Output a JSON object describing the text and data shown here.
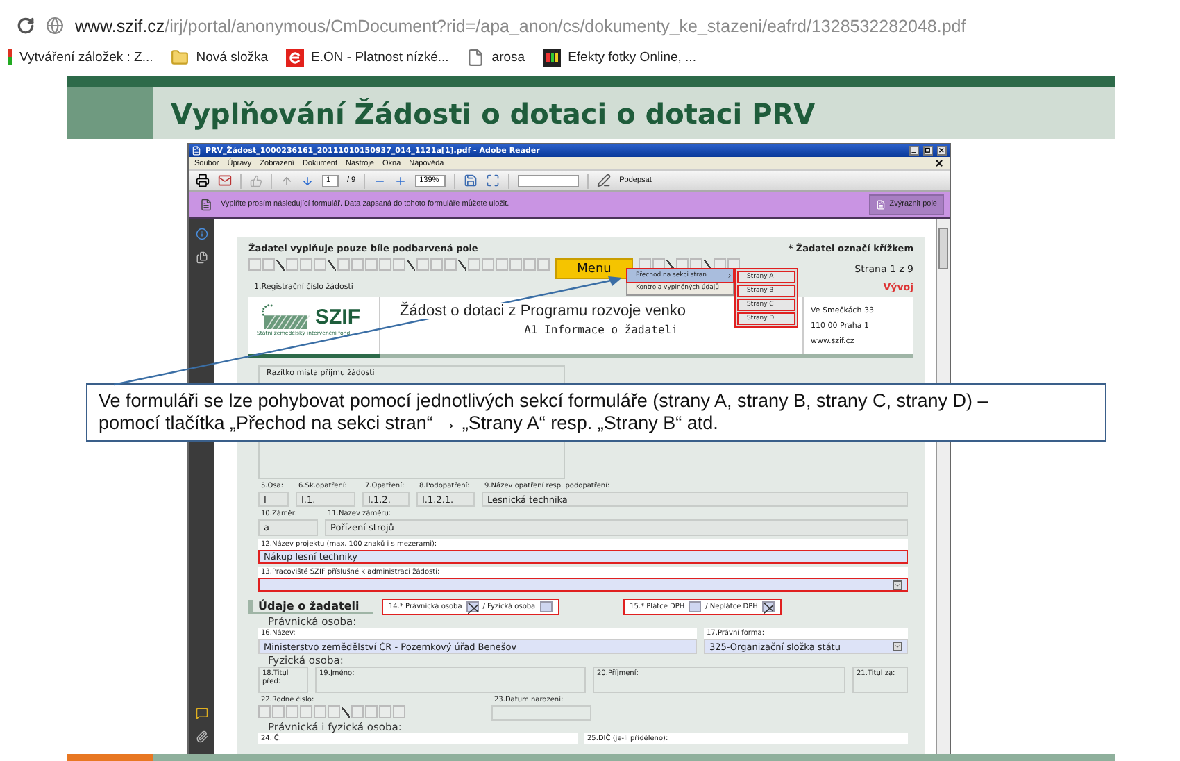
{
  "browser": {
    "url_host": "www.szif.cz",
    "url_path": "/irj/portal/anonymous/CmDocument?rid=/apa_anon/cs/dokumenty_ke_stazeni/eafrd/1328532282048.pdf",
    "bookmarks": [
      {
        "label": "Vytváření záložek : Z...",
        "kind": "bar"
      },
      {
        "label": "Nová složka",
        "kind": "folder"
      },
      {
        "label": "E.ON - Platnost nízké...",
        "kind": "eon"
      },
      {
        "label": "arosa",
        "kind": "page"
      },
      {
        "label": "Efekty fotky Online, ...",
        "kind": "pix"
      }
    ]
  },
  "slide": {
    "title": "Vyplňování Žádosti o dotaci o dotaci PRV",
    "callout": [
      "Ve formuláři se lze pohybovat pomocí jednotlivých sekcí formuláře (strany A, strany B, strany C, strany D) –",
      "pomocí tlačítka „Přechod na sekci stran“ → „Strany A“ resp. „Strany B“ atd."
    ]
  },
  "reader": {
    "title": "PRV_Žádost_1000236161_20111010150937_014_1121a[1].pdf - Adobe Reader",
    "menu": [
      "Soubor",
      "Úpravy",
      "Zobrazení",
      "Dokument",
      "Nástroje",
      "Okna",
      "Nápověda"
    ],
    "toolbar": {
      "page": "1",
      "pages": "/ 9",
      "zoom": "139%",
      "sign": "Podepsat"
    },
    "notice": "Vyplňte prosím následující formulář. Data zapsaná do tohoto formuláře můžete uložit.",
    "highlight_button": "Zvýraznit pole",
    "form": {
      "header_left": "Žadatel vyplňuje pouze bíle podbarvená pole",
      "header_right": "* Žadatel označí křížkem",
      "menu_button": "Menu",
      "page_info": "Strana 1 z 9",
      "reg_label": "1.Registrační číslo žádosti",
      "status": "Vývoj",
      "dropdown": [
        {
          "label": "Přechod na sekci stran",
          "selected": true
        },
        {
          "label": "Kontrola vyplněných údajů",
          "selected": false
        }
      ],
      "submenu": [
        "Strany A",
        "Strany B",
        "Strany C",
        "Strany D"
      ],
      "logo": {
        "mark": "SZIF",
        "subtitle": "Státní zemědělský intervenční fond"
      },
      "doc_title": "Žádost o dotaci z Programu rozvoje venko",
      "doc_subtitle": "A1 Informace o žadateli",
      "address": [
        "Ve Smečkách 33",
        "110 00 Praha 1",
        "www.szif.cz"
      ],
      "stamp_label": "Razítko místa příjmu žádosti",
      "row1": [
        {
          "label": "5.Osa:",
          "value": "I"
        },
        {
          "label": "6.Sk.opatření:",
          "value": "I.1."
        },
        {
          "label": "7.Opatření:",
          "value": "I.1.2."
        },
        {
          "label": "8.Podopatření:",
          "value": "I.1.2.1."
        },
        {
          "label": "9.Název opatření resp. podopatření:",
          "value": "Lesnická technika"
        }
      ],
      "row2": [
        {
          "label": "10.Záměr:",
          "value": "a"
        },
        {
          "label": "11.Název záměru:",
          "value": "Pořízení strojů"
        }
      ],
      "project": {
        "label": "12.Název projektu (max. 100 znaků i s mezerami):",
        "value": "Nákup lesní techniky"
      },
      "office": {
        "label": "13.Pracoviště SZIF příslušné k administraci žádosti:"
      },
      "section": "Údaje o žadateli",
      "checks": [
        {
          "items": [
            {
              "label": "14.* Právnická osoba",
              "checked": true
            },
            {
              "label": "/  Fyzická osoba",
              "checked": false
            }
          ]
        },
        {
          "items": [
            {
              "label": "15.* Plátce DPH",
              "checked": false
            },
            {
              "label": "/  Neplátce DPH",
              "checked": true
            }
          ]
        }
      ],
      "legal": {
        "heading": "Právnická osoba:",
        "fields": [
          {
            "label": "16.Název:",
            "value": "Ministerstvo zemědělství ČR - Pozemkový úřad Benešov",
            "kind": "text"
          },
          {
            "label": "17.Právní forma:",
            "value": "325-Organizační složka státu",
            "kind": "select"
          }
        ]
      },
      "natural": {
        "heading": "Fyzická osoba:",
        "fields": [
          "18.Titul před:",
          "19.Jméno:",
          "20.Příjmení:",
          "21.Titul za:"
        ],
        "birth_number": "22.Rodné číslo:",
        "birth_date": "23.Datum narození:"
      },
      "both": {
        "heading": "Právnická i fyzická osoba:",
        "fields": [
          "24.IČ:",
          "25.DIČ (je-li přiděleno):"
        ]
      }
    }
  }
}
